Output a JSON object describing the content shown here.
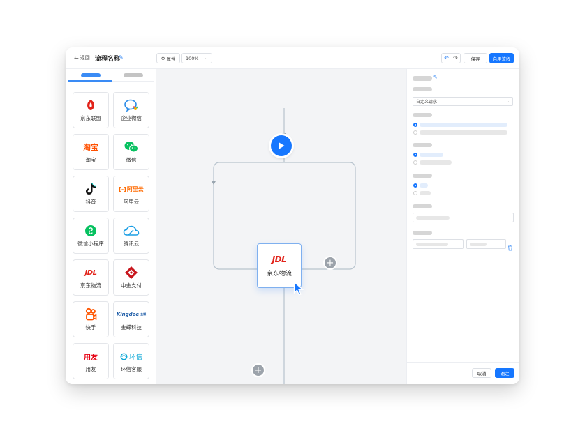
{
  "header": {
    "back_label": "返回",
    "flow_title": "流程名称",
    "properties_label": "属性",
    "zoom_value": "100%",
    "save_label": "保存",
    "enable_label": "启用流程"
  },
  "sidebar": {
    "items": [
      {
        "label": "京东联盟",
        "icon": "jd-union-icon"
      },
      {
        "label": "企业微信",
        "icon": "wecom-icon"
      },
      {
        "label": "淘宝",
        "icon": "taobao-icon",
        "logo_text": "淘宝"
      },
      {
        "label": "微信",
        "icon": "wechat-icon"
      },
      {
        "label": "抖音",
        "icon": "douyin-icon"
      },
      {
        "label": "阿里云",
        "icon": "aliyun-icon",
        "logo_text": "阿里云"
      },
      {
        "label": "微信小程序",
        "icon": "wechat-miniprogram-icon"
      },
      {
        "label": "腾讯云",
        "icon": "tencent-cloud-icon"
      },
      {
        "label": "京东物流",
        "icon": "jdl-icon",
        "logo_text": "JDL"
      },
      {
        "label": "中金支付",
        "icon": "cpcn-icon"
      },
      {
        "label": "快手",
        "icon": "kuaishou-icon"
      },
      {
        "label": "金蝶科技",
        "icon": "kingdee-icon",
        "logo_text": "Kingdee",
        "logo_sub": "金蝶"
      },
      {
        "label": "用友",
        "icon": "yonyou-icon",
        "logo_text": "用友"
      },
      {
        "label": "环信客服",
        "icon": "easemob-icon",
        "logo_text": "环信"
      }
    ]
  },
  "canvas": {
    "node_label": "京东物流",
    "node_logo_text": "JDL"
  },
  "panel": {
    "request_type": "自定义请求",
    "cancel_label": "取消",
    "ok_label": "确定"
  },
  "colors": {
    "accent": "#1677ff",
    "jd_red": "#e2231a",
    "taobao_orange": "#ff5000",
    "wechat_green": "#07c160"
  }
}
